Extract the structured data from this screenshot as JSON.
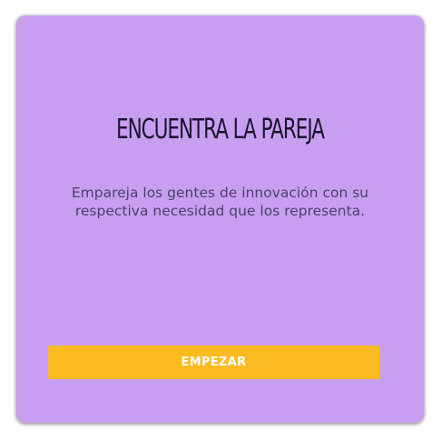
{
  "card": {
    "title": "ENCUENTRA LA PAREJA",
    "description": "Empareja los gentes de innovación con su respectiva necesidad que los representa.",
    "start_label": "EMPEZAR"
  },
  "colors": {
    "card_background": "#c89ff0",
    "button_background": "#fbbb21",
    "title_text": "#1a1430",
    "description_text": "#4a3f6e"
  }
}
